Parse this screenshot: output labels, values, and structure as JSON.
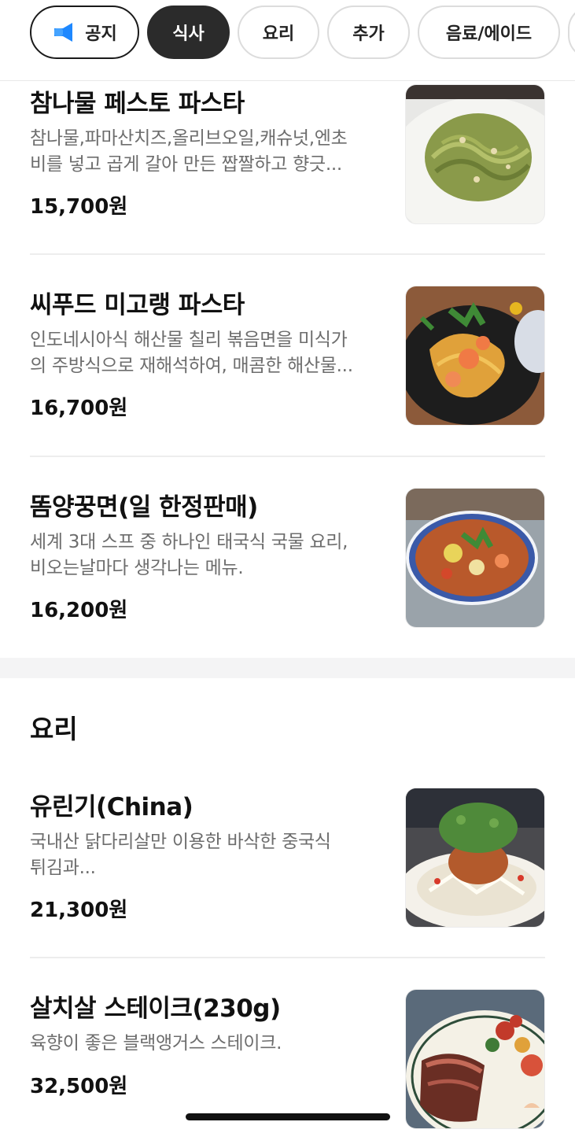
{
  "tabs": [
    {
      "label": "공지",
      "icon": "megaphone-icon",
      "style": "notice"
    },
    {
      "label": "식사",
      "style": "active"
    },
    {
      "label": "요리",
      "style": "normal"
    },
    {
      "label": "추가",
      "style": "normal"
    },
    {
      "label": "음료/에이드",
      "style": "normal"
    }
  ],
  "meal_items": [
    {
      "name": "참나물 페스토 파스타",
      "desc_line1": "참나물,파마산치즈,올리브오일,캐슈넛,엔초",
      "desc_line2": "비를 넣고 곱게 갈아 만든 짭짤하고 향긋...",
      "price": "15,700원",
      "image": "pesto-pasta-photo"
    },
    {
      "name": "씨푸드 미고랭 파스타",
      "desc_line1": "인도네시아식 해산물 칠리 볶음면을 미식가",
      "desc_line2": "의 주방식으로 재해석하여, 매콤한 해산물...",
      "price": "16,700원",
      "image": "seafood-mi-goreng-photo"
    },
    {
      "name": "똠양꿍면(일 한정판매)",
      "desc_line1": "세계 3대 스프 중 하나인 태국식 국물 요리,",
      "desc_line2": "비오는날마다 생각나는 메뉴.",
      "price": "16,200원",
      "image": "tom-yum-noodle-photo"
    }
  ],
  "section_title": "요리",
  "dish_items": [
    {
      "name": "유린기(China)",
      "desc_line1": "국내산 닭다리살만 이용한 바삭한 중국식",
      "desc_line2": "튀김과...",
      "price": "21,300원",
      "image": "yuringi-photo"
    },
    {
      "name": "살치살 스테이크(230g)",
      "desc_line1": "육향이 좋은 블랙앵거스 스테이크.",
      "desc_line2": "",
      "price": "32,500원",
      "image": "steak-photo"
    }
  ],
  "colors": {
    "active_tab": "#2b2b2b",
    "notice_icon": "#1e88ff",
    "desc_text": "#6d6d6d"
  }
}
